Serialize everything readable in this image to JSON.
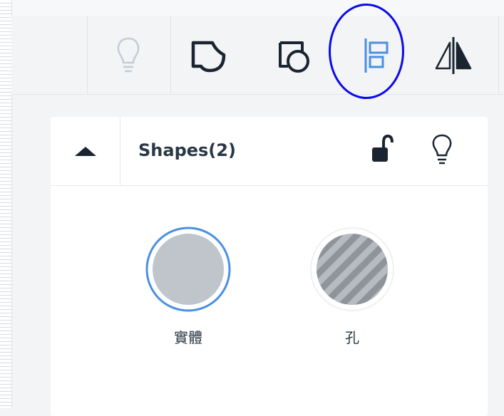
{
  "toolbar": {
    "tools": [
      {
        "icon": "lightbulb-icon",
        "state": "disabled"
      },
      {
        "icon": "shape-union-icon",
        "state": "normal"
      },
      {
        "icon": "shape-subtract-icon",
        "state": "normal"
      },
      {
        "icon": "align-left-icon",
        "state": "active"
      },
      {
        "icon": "mirror-icon",
        "state": "normal"
      }
    ],
    "active_color": "#4a90e2",
    "highlight_color": "#0a0ae6"
  },
  "panel": {
    "title": "Shapes(2)",
    "collapse_icon": "triangle-up-icon",
    "actions": [
      {
        "icon": "unlock-icon"
      },
      {
        "icon": "lightbulb-icon"
      }
    ],
    "shapes": [
      {
        "label": "實體",
        "icon": "solid-shape-icon",
        "selected": true
      },
      {
        "label": "孔",
        "icon": "hole-shape-icon",
        "selected": false
      }
    ]
  }
}
